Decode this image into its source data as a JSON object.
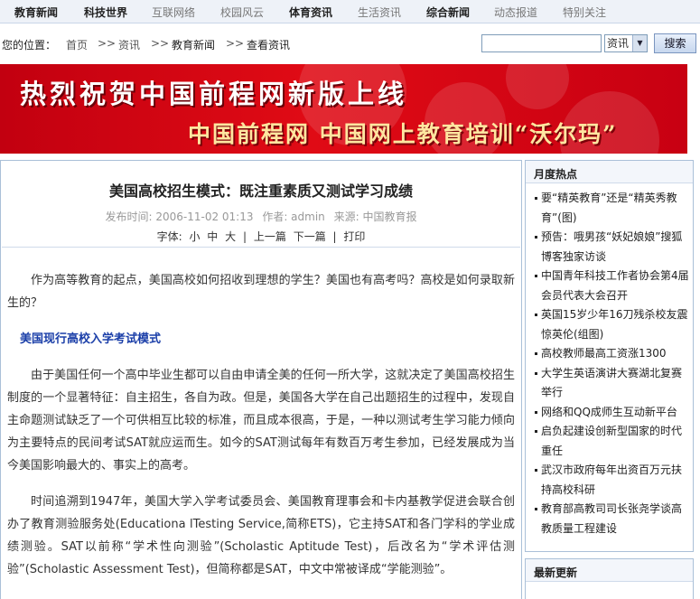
{
  "topnav": [
    {
      "label": "教育新闻",
      "active": true
    },
    {
      "label": "科技世界",
      "active": true
    },
    {
      "label": "互联网络",
      "active": false
    },
    {
      "label": "校园风云",
      "active": false
    },
    {
      "label": "体育资讯",
      "active": true
    },
    {
      "label": "生活资讯",
      "active": false
    },
    {
      "label": "综合新闻",
      "active": true
    },
    {
      "label": "动态报道",
      "active": false
    },
    {
      "label": "特别关注",
      "active": false
    }
  ],
  "location": {
    "label": "您的位置：",
    "crumbs": [
      "首页",
      ">>",
      "资讯",
      ">>",
      "教育新闻",
      ">>",
      "查看资讯"
    ]
  },
  "search": {
    "select_value": "资讯",
    "button_label": "搜索"
  },
  "banner": {
    "title": "热烈祝贺中国前程网新版上线",
    "subtitle": "中国前程网  中国网上教育培训“沃尔玛”"
  },
  "article": {
    "title": "美国高校招生模式：既注重素质又测试学习成绩",
    "meta": {
      "time": "发布时间: 2006-11-02 01:13",
      "author": "作者: admin",
      "source": "来源: 中国教育报"
    },
    "tools": [
      "字体:",
      "小",
      "中",
      "大",
      "|",
      "上一篇",
      "下一篇",
      "|",
      "打印"
    ],
    "intro": "作为高等教育的起点，美国高校如何招收到理想的学生？美国也有高考吗？高校是如何录取新生的？",
    "section_heading": "美国现行高校入学考试模式",
    "para1": "由于美国任何一个高中毕业生都可以自由申请全美的任何一所大学，这就决定了美国高校招生制度的一个显著特征：自主招生，各自为政。但是，美国各大学在自己出题招生的过程中，发现自主命题测试缺乏了一个可供相互比较的标准，而且成本很高，于是，一种以测试考生学习能力倾向为主要特点的民间考试SAT就应运而生。如今的SAT测试每年有数百万考生参加，已经发展成为当今美国影响最大的、事实上的高考。",
    "para2": "时间追溯到1947年，美国大学入学考试委员会、美国教育理事会和卡内基教学促进会联合创办了教育测验服务处(Educationa lTesting Service,简称ETS)，它主持SAT和各门学科的学业成绩测验。SAT以前称“学术性向测验”(Scholastic Aptitude Test)，后改名为“学术评估测验”(Scholastic Assessment Test)，但简称都是SAT，中文中常被译成“学能测验”。"
  },
  "sidebar": {
    "monthly_title": "月度热点",
    "monthly_items": [
      "要“精英教育”还是“精英秀教育”(图)",
      "预告：哦男孩“妖妃娘娘”搜狐博客独家访谈",
      "中国青年科技工作者协会第4届会员代表大会召开",
      "英国15岁少年16刀残杀校友震惊英伦(组图)",
      "高校教师最高工资涨1300",
      "大学生英语演讲大赛湖北复赛举行",
      "网络和QQ成师生互动新平台",
      "启负起建设创新型国家的时代重任",
      "武汉市政府每年出资百万元扶持高校科研",
      "教育部高教司司长张尧学谈高教质量工程建设"
    ],
    "latest_title": "最新更新"
  }
}
